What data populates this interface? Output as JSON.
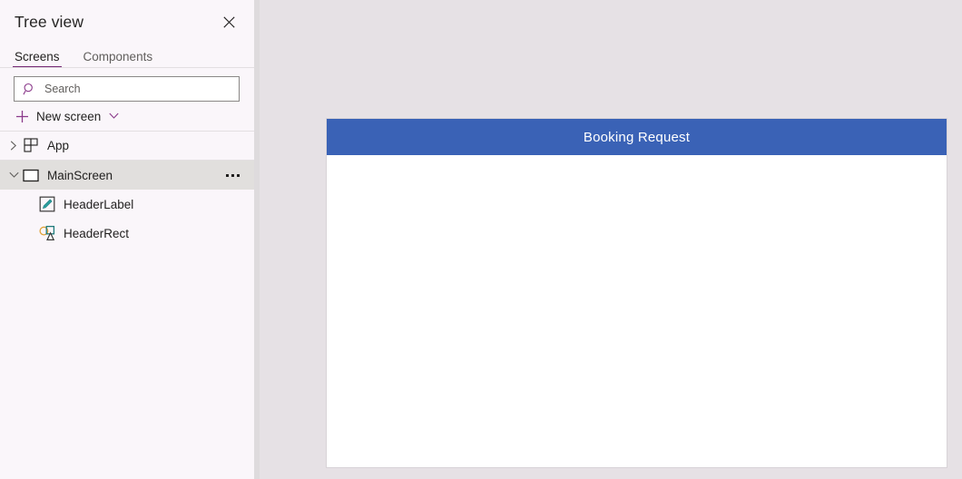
{
  "panel": {
    "title": "Tree view",
    "close_icon": "close-icon",
    "tabs": [
      {
        "label": "Screens",
        "active": true
      },
      {
        "label": "Components",
        "active": false
      }
    ],
    "search": {
      "placeholder": "Search",
      "value": "",
      "icon": "search-icon"
    },
    "new_screen": {
      "label": "New screen",
      "plus_icon": "plus-icon",
      "chevron_icon": "chevron-down-icon"
    },
    "tree": [
      {
        "label": "App",
        "icon": "app-grid-icon",
        "twisty": "chevron-right-icon",
        "expanded": false,
        "indent": 1,
        "selected": false,
        "more": false
      },
      {
        "label": "MainScreen",
        "icon": "screen-icon",
        "twisty": "chevron-down-icon",
        "expanded": true,
        "indent": 1,
        "selected": true,
        "more": true,
        "more_icon": "more-options-icon"
      },
      {
        "label": "HeaderLabel",
        "icon": "label-pencil-icon",
        "twisty": "",
        "expanded": false,
        "indent": 2,
        "selected": false,
        "more": false
      },
      {
        "label": "HeaderRect",
        "icon": "shapes-icon",
        "twisty": "",
        "expanded": false,
        "indent": 2,
        "selected": false,
        "more": false
      }
    ]
  },
  "canvas": {
    "background_color": "#e6e1e5",
    "screen_background": "#ffffff",
    "header_rect_color": "#3a62b6",
    "header_label_text": "Booking Request",
    "header_label_color": "#ffffff"
  },
  "colors": {
    "accent_purple": "#742774",
    "panel_background": "#faf6fa",
    "selected_row": "#e1dfdd"
  }
}
